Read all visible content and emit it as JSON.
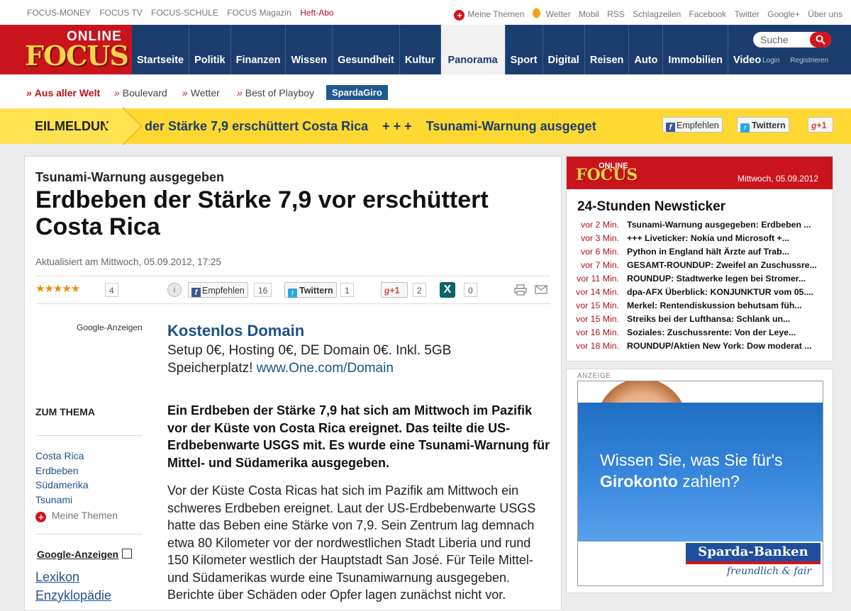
{
  "topbar": {
    "left_links": [
      "FOCUS-MONEY",
      "FOCUS TV",
      "FOCUS-SCHULE",
      "FOCUS Magazin"
    ],
    "abo": "Heft-Abo",
    "meine_themen": "Meine Themen",
    "right_links": [
      "Wetter",
      "Mobil",
      "RSS",
      "Schlagzeilen",
      "Facebook",
      "Twitter",
      "Google+",
      "Über uns"
    ]
  },
  "logo": {
    "online": "ONLINE",
    "focus": "FOCUS"
  },
  "nav": [
    "Startseite",
    "Politik",
    "Finanzen",
    "Wissen",
    "Gesundheit",
    "Kultur",
    "Panorama",
    "Sport",
    "Digital",
    "Reisen",
    "Auto",
    "Immobilien",
    "Video"
  ],
  "nav_active": "Panorama",
  "search": {
    "placeholder": "Suche",
    "login": "Login",
    "register": "Registrieren"
  },
  "subnav": {
    "items": [
      "Aus aller Welt",
      "Boulevard",
      "Wetter",
      "Best of Playboy"
    ],
    "sparda": "SpardaGiro"
  },
  "breaking": {
    "label": "EILMELDUNG",
    "ticker": "der Stärke 7,9 erschüttert Costa Rica    + + +    Tsunami-Warnung ausgeget",
    "fb": "Empfehlen",
    "tw": "Twittern",
    "gplus": "+1"
  },
  "article": {
    "kicker": "Tsunami-Warnung ausgegeben",
    "headline": "Erdbeben der Stärke 7,9 vor erschüttert Costa Rica",
    "updated": "Aktualisiert am Mittwoch, 05.09.2012, 17:25",
    "rating": {
      "stars": 5,
      "count": "4"
    },
    "share": {
      "fb_label": "Empfehlen",
      "fb_count": "16",
      "tw_label": "Twittern",
      "tw_count": "1",
      "gplus_label": "+1",
      "gplus_count": "2",
      "xing_count": "0"
    },
    "google_ads_label": "Google-Anzeigen",
    "ad_title": "Kostenlos Domain",
    "ad_text": "Setup 0€, Hosting 0€, DE Domain 0€. Inkl. 5GB Speicherplatz!",
    "ad_link": "www.One.com/Domain",
    "zum_thema": "ZUM THEMA",
    "topics": [
      "Costa Rica",
      "Erdbeben",
      "Südamerika",
      "Tsunami"
    ],
    "meine_themen": "Meine Themen",
    "google_ads2": "Google-Anzeigen",
    "lexikon": [
      "Lexikon",
      "Enzyklopädie"
    ],
    "lead": "Ein Erdbeben der Stärke 7,9 hat sich am Mittwoch im Pazifik vor der Küste von Costa Rica ereignet. Das teilte die US-Erdbebenwarte USGS mit. Es wurde eine Tsunami-Warnung für Mittel- und Südamerika ausgegeben.",
    "body": "Vor der Küste Costa Ricas hat sich im Pazifik am Mittwoch ein schweres Erdbeben ereignet. Laut der US-Erdbebenwarte USGS hatte das Beben eine Stärke von 7,9. Sein Zentrum lag demnach etwa 80 Kilometer vor der nordwestlichen Stadt Liberia und rund 150 Kilometer westlich der Hauptstadt San José. Für Teile Mittel- und Südamerikas wurde eine Tsunamiwarnung ausgegeben. Berichte über Schäden oder Opfer lagen zunächst nicht vor."
  },
  "newsticker": {
    "online": "ONLINE",
    "focus": "FOCUS",
    "date": "Mittwoch, 05.09.2012",
    "title": "24-Stunden Newsticker",
    "items": [
      {
        "time": "vor 2 Min.",
        "headline": "Tsunami-Warnung ausgegeben: Erdbeben ..."
      },
      {
        "time": "vor 3 Min.",
        "headline": "+++ Liveticker: Nokia und Microsoft +..."
      },
      {
        "time": "vor 6 Min.",
        "headline": "Python in England hält Ärzte auf Trab..."
      },
      {
        "time": "vor 7 Min.",
        "headline": "GESAMT-ROUNDUP: Zweifel an Zuschussre..."
      },
      {
        "time": "vor 11 Min.",
        "headline": "ROUNDUP: Stadtwerke legen bei Stromer..."
      },
      {
        "time": "vor 14 Min.",
        "headline": "dpa-AFX Überblick: KONJUNKTUR vom 05...."
      },
      {
        "time": "vor 15 Min.",
        "headline": "Merkel: Rentendiskussion behutsam füh..."
      },
      {
        "time": "vor 15 Min.",
        "headline": "Streiks bei der Lufthansa: Schlank un..."
      },
      {
        "time": "vor 16 Min.",
        "headline": "Soziales: Zuschussrente: Von der Leye..."
      },
      {
        "time": "vor 18 Min.",
        "headline": "ROUNDUP/Aktien New York: Dow moderat ..."
      }
    ]
  },
  "ad_right": {
    "label": "ANZEIGE",
    "line1": "Wissen Sie, was Sie für's",
    "line2_bold": "Girokonto",
    "line2_rest": " zahlen?",
    "brand": "Sparda-Banken",
    "slogan": "freundlich & fair"
  },
  "colors": {
    "brand_red": "#c9141c",
    "nav_blue": "#1b3d6e",
    "breaking_yellow": "#ffd832",
    "link_blue": "#1f4f8b"
  }
}
